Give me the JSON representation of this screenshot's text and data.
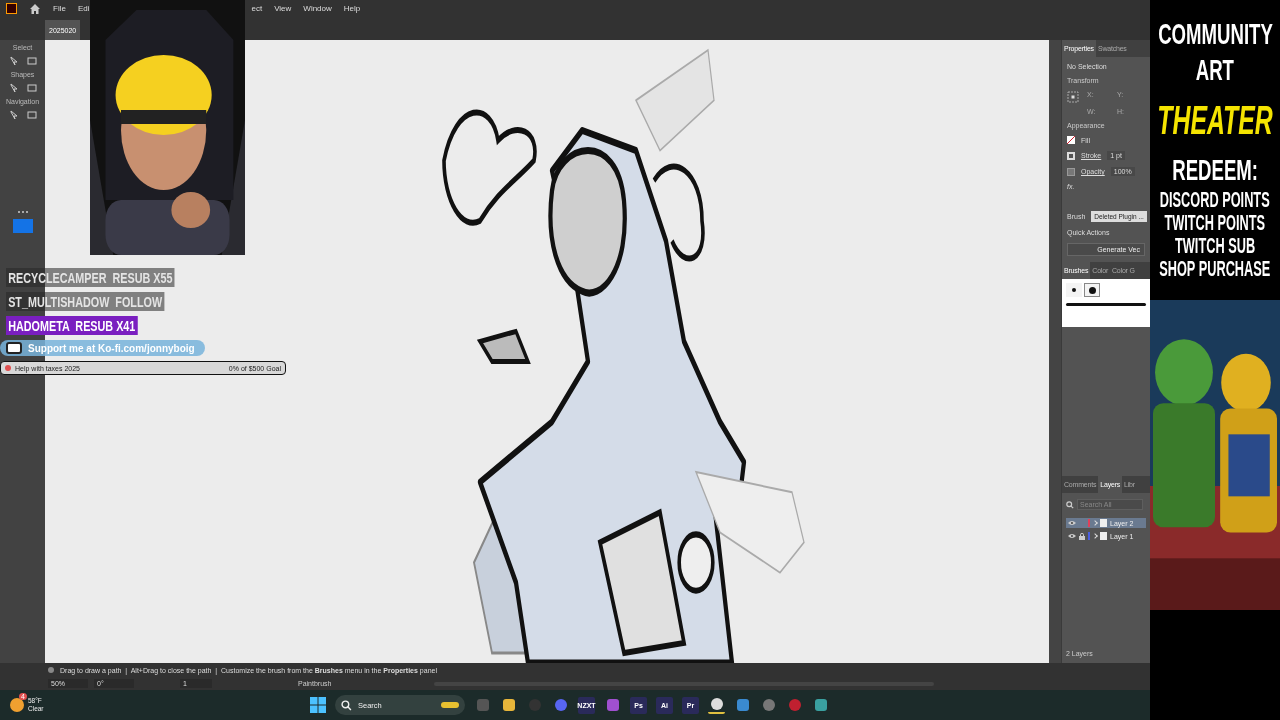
{
  "menu_bar": {
    "items": [
      "File",
      "Edi",
      "ect",
      "View",
      "Window",
      "Help"
    ]
  },
  "document_tabs": [
    {
      "label": "2025020",
      "selected": true
    }
  ],
  "toolbar": {
    "sections": [
      "Select",
      "Shapes",
      "Navigation"
    ]
  },
  "stream_overlay": {
    "events": [
      {
        "text": "RECYCLECAMPER  RESUB X55",
        "highlighted": false
      },
      {
        "text": "ST_MULTISHADOW  FOLLOW",
        "highlighted": false
      },
      {
        "text": "HADOMETA  RESUB X41",
        "highlighted": true
      }
    ],
    "support": "Support me at Ko-fi.com/jonnyboig",
    "goal": {
      "label": "Help with taxes 2025",
      "reading": "0% of $500 Goal",
      "level": 0
    }
  },
  "properties_panel": {
    "tabs": [
      {
        "label": "Properties",
        "selected": true
      },
      {
        "label": "Swatches",
        "selected": false
      }
    ],
    "status": "No Selection",
    "transform_title": "Transform",
    "coords": [
      "X:",
      "Y:",
      "W:",
      "H:"
    ],
    "appearance_title": "Appearance",
    "fill": "Fill",
    "stroke": "Stroke",
    "stroke_value": "1 pt",
    "opacity": "Opacity",
    "opacity_value": "100%",
    "fx": "fx.",
    "brush_label": "Brush",
    "brush_value": "Deleted Plugin ...",
    "quick_actions": "Quick Actions",
    "generate": "Generate Vec"
  },
  "brushes_panel": {
    "tabs": [
      {
        "label": "Brushes",
        "selected": true
      },
      {
        "label": "Color",
        "selected": false
      },
      {
        "label": "Color G",
        "selected": false
      }
    ]
  },
  "layers_panel": {
    "tabs": [
      {
        "label": "Comments",
        "selected": false
      },
      {
        "label": "Layers",
        "selected": true
      },
      {
        "label": "Libr",
        "selected": false
      }
    ],
    "search": {
      "placeholder": "Search All"
    },
    "layers": [
      {
        "name": "Layer 2",
        "selected": true,
        "locked": false,
        "color": "#e0405a"
      },
      {
        "name": "Layer 1",
        "selected": false,
        "locked": true,
        "color": "#4a5ee0"
      }
    ],
    "count": "2 Layers"
  },
  "status_bar": {
    "hint": "Drag to draw a path  |  Alt+Drag to close the path  |  Customize the brush from the **Brushes** menu in the **Properties** panel",
    "zoom": "50%",
    "rotation": "0°",
    "artboard": "1",
    "tool": "Paintbrush"
  },
  "taskbar": {
    "weather": {
      "badge": "4",
      "temp": "58°F",
      "condition": "Clear"
    },
    "search": "Search",
    "apps": [
      {
        "kind": "files"
      },
      {
        "kind": "folder"
      },
      {
        "kind": "obs"
      },
      {
        "kind": "discord"
      },
      {
        "kind": "text",
        "label": "NZXT"
      },
      {
        "kind": "camera"
      },
      {
        "kind": "text",
        "label": "Ps"
      },
      {
        "kind": "text",
        "label": "Ai"
      },
      {
        "kind": "text",
        "label": "Pr"
      },
      {
        "kind": "browser",
        "selected": true
      },
      {
        "kind": "diamond"
      },
      {
        "kind": "robot"
      },
      {
        "kind": "ring"
      },
      {
        "kind": "monitor"
      }
    ]
  },
  "stream_sidebar": {
    "title": [
      "COMMUNITY",
      "ART"
    ],
    "highlight": "THEATER",
    "redeem": "REDEEM:",
    "options": [
      "DISCORD POINTS",
      "TWITCH POINTS",
      "TWITCH SUB",
      "SHOP PURCHASE"
    ]
  }
}
